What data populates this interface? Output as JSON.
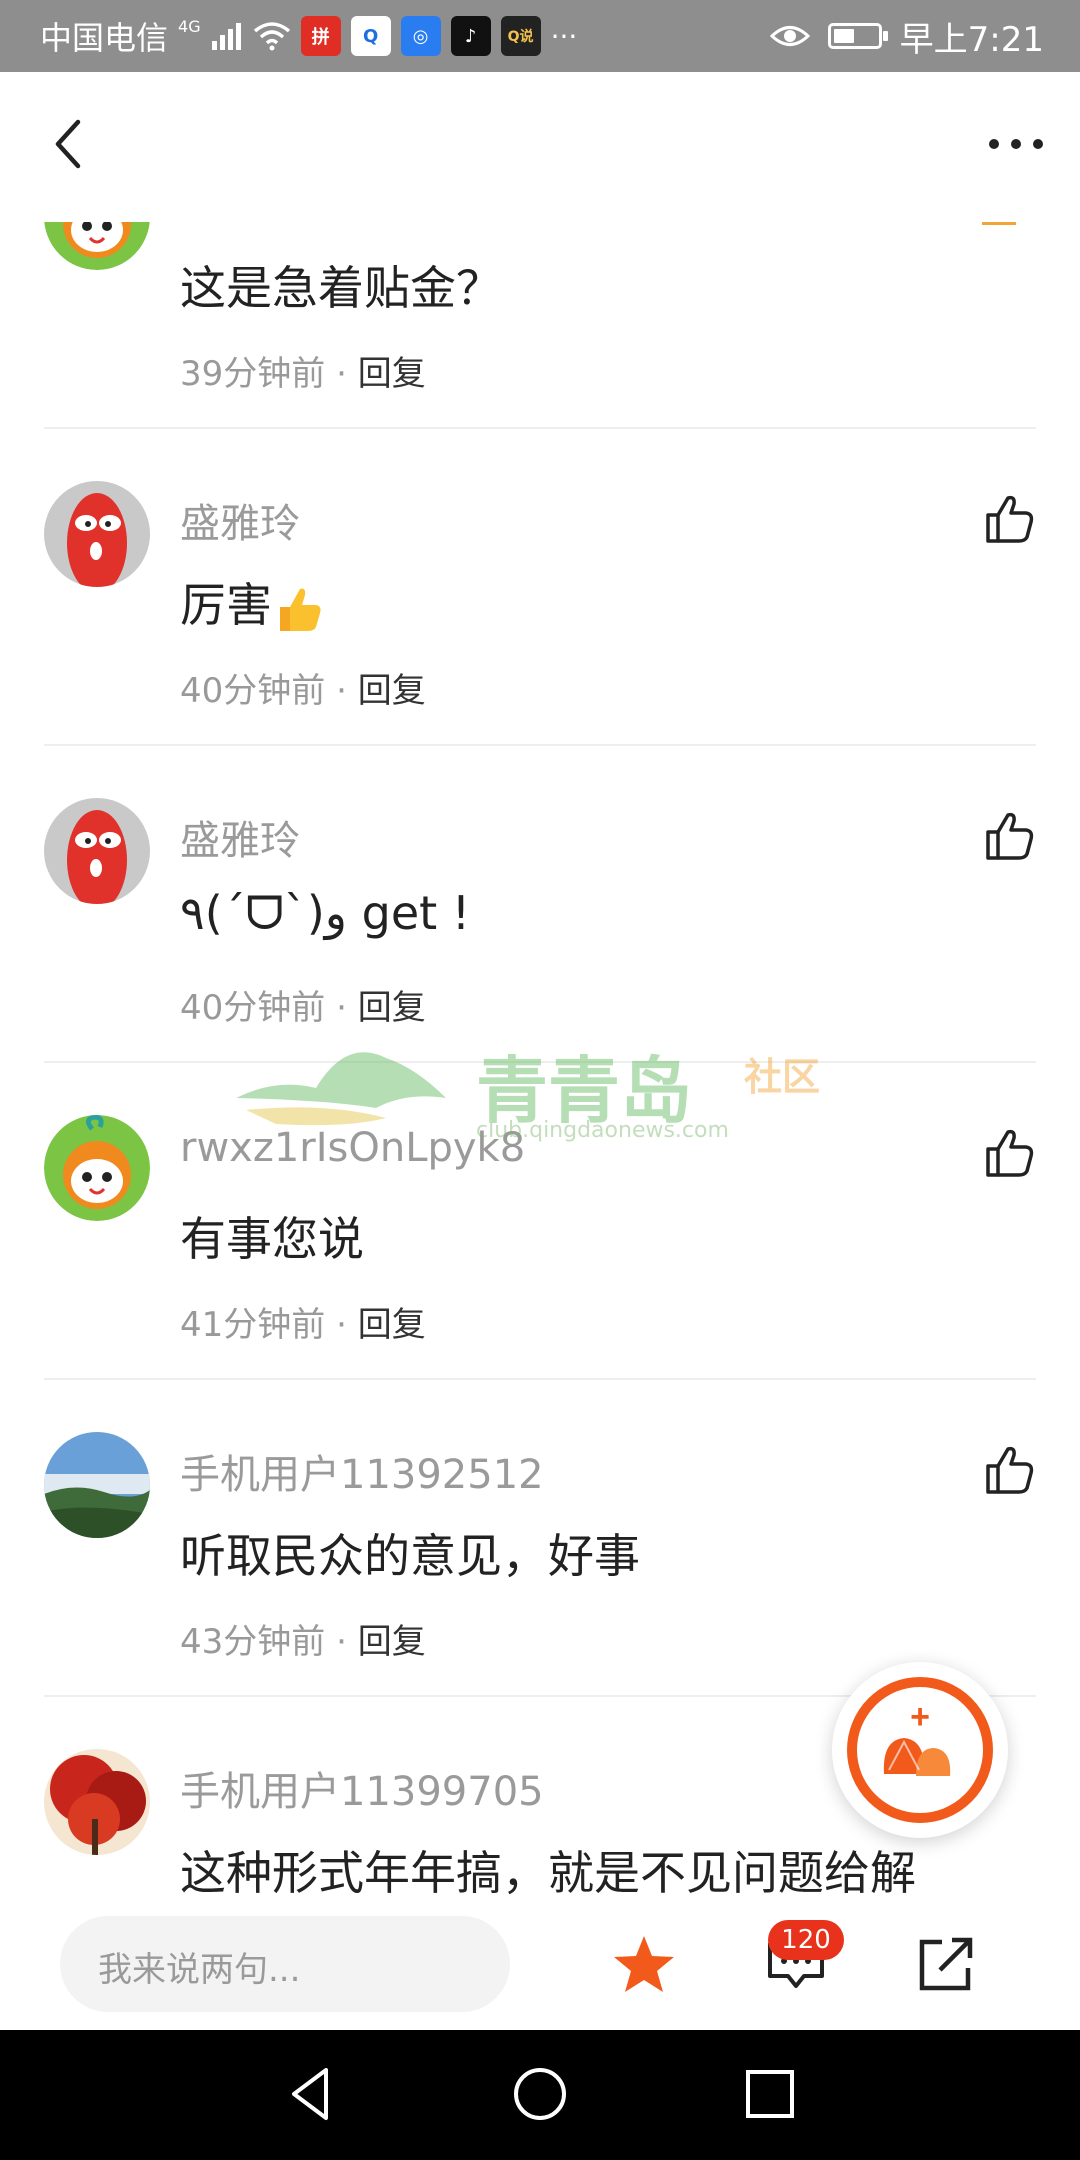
{
  "status_bar": {
    "carrier": "中国电信",
    "network": "4G",
    "time": "早上7:21",
    "battery_level": 0.55,
    "more": "···",
    "app_icons": [
      "pinduoduo-icon",
      "q-app-icon",
      "browser-icon",
      "tiktok-icon",
      "news-icon"
    ]
  },
  "top_bar": {
    "back_icon": "chevron-left-icon",
    "more_icon": "more-horizontal-icon"
  },
  "comments": [
    {
      "avatar": "cartoon-mascot-avatar",
      "name": "",
      "text": "这是急着贴金？",
      "time": "39分钟前",
      "reply": "回复"
    },
    {
      "avatar": "red-sausage-avatar",
      "name": "盛雅玲",
      "text": "厉害",
      "emoji": "thumbs-up-emoji",
      "time": "40分钟前",
      "reply": "回复"
    },
    {
      "avatar": "red-sausage-avatar",
      "name": "盛雅玲",
      "text": "٩(ˊᗜˋ)و get !",
      "time": "40分钟前",
      "reply": "回复"
    },
    {
      "avatar": "cartoon-mascot-avatar",
      "name": "rwxz1rIsOnLpyk8",
      "text": "有事您说",
      "time": "41分钟前",
      "reply": "回复"
    },
    {
      "avatar": "landscape-photo-avatar",
      "name": "手机用户11392512",
      "text": "听取民众的意见，好事",
      "time": "43分钟前",
      "reply": "回复"
    },
    {
      "avatar": "red-tree-photo-avatar",
      "name": "手机用户11399705",
      "text": "这种形式年年搞，就是不见问题给解",
      "time": "",
      "reply": ""
    }
  ],
  "separator": "·",
  "watermark": {
    "brand": "青青岛",
    "suffix": "社区",
    "url": "club.qingdaonews.com"
  },
  "fab": {
    "icon": "shell-add-icon",
    "plus": "+"
  },
  "bottom_bar": {
    "input_placeholder": "我来说两句...",
    "comment_count": "120"
  },
  "colors": {
    "accent_orange": "#f25a1c",
    "badge_red": "#e8321c",
    "status_bar_gray": "#8e8e8e"
  }
}
